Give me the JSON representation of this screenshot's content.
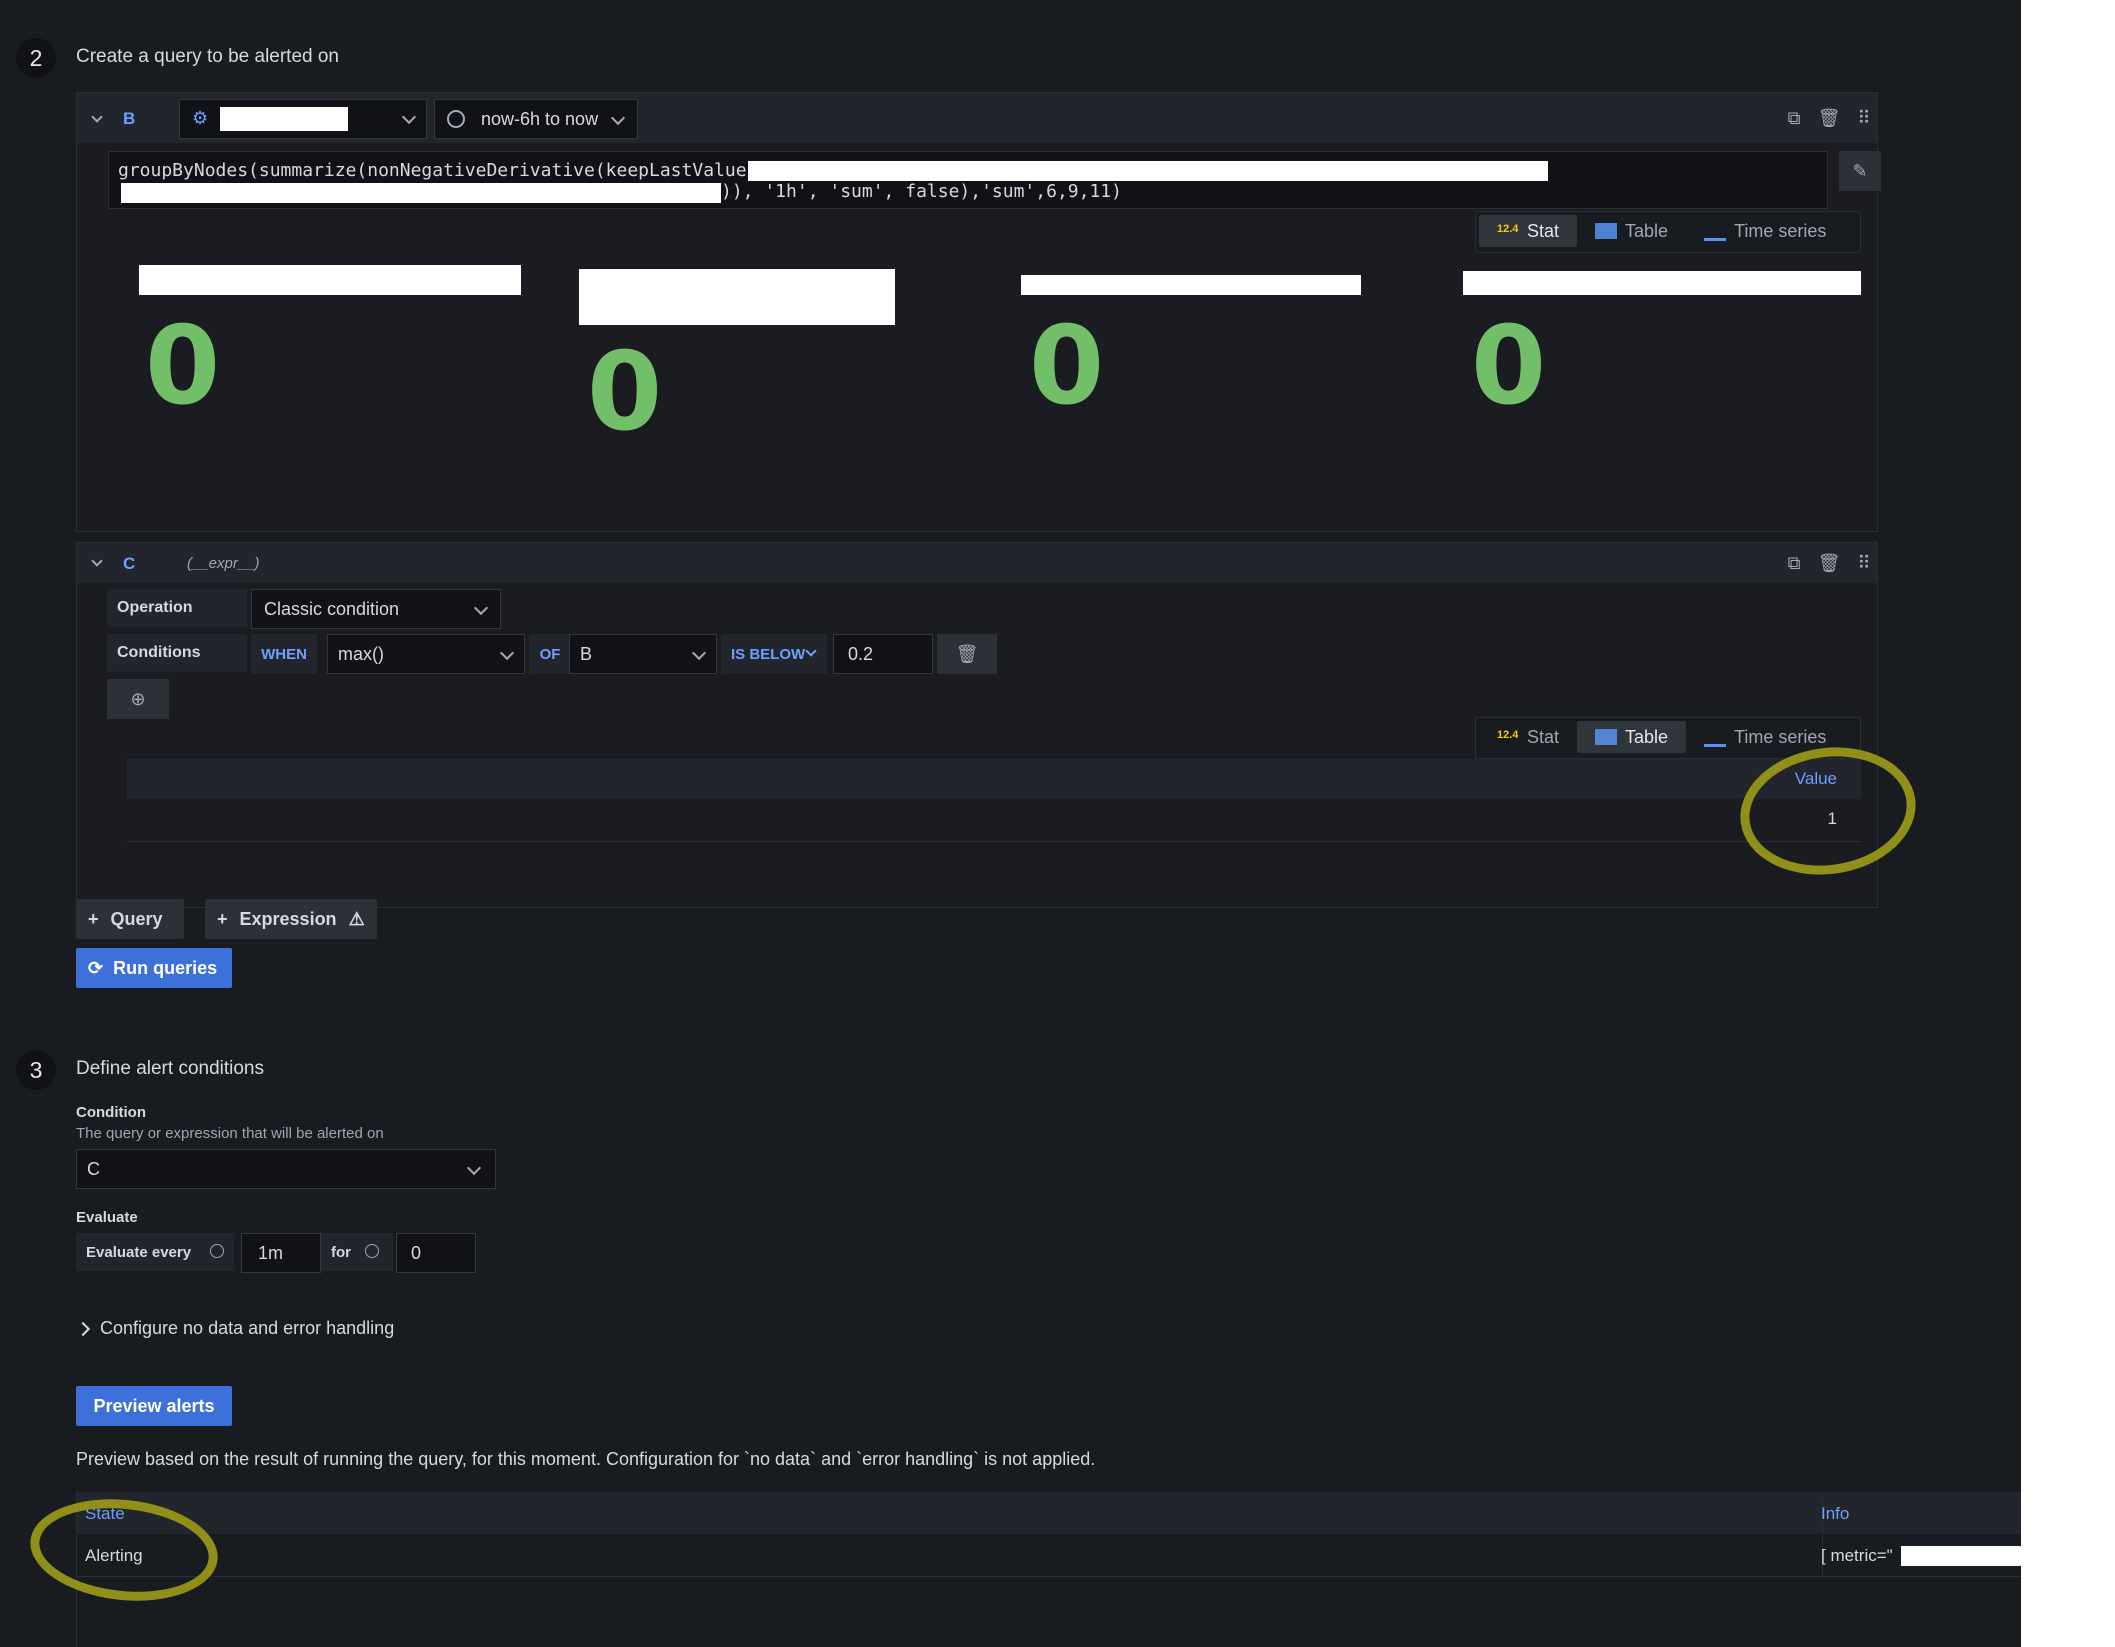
{
  "step2": {
    "number": "2",
    "title": "Create a query to be alerted on",
    "query_b": {
      "ref_id": "B",
      "time_range": "now-6h to now",
      "query_line1": "groupByNodes(summarize(nonNegativeDerivative(keepLastValue(",
      "query_line2_tail": ")), '1h', 'sum', false),'sum',6,9,11)",
      "views": [
        "Stat",
        "Table",
        "Time series"
      ],
      "active_view": "Stat",
      "stats": [
        "0",
        "0",
        "0",
        "0"
      ]
    },
    "expr_c": {
      "ref_id": "C",
      "name": "(__expr__)",
      "operation_label": "Operation",
      "operation_value": "Classic condition",
      "conditions_label": "Conditions",
      "when_label": "WHEN",
      "reducer": "max()",
      "of_label": "OF",
      "query_ref": "B",
      "evaluator": "IS BELOW",
      "threshold": "0.2",
      "views": [
        "Stat",
        "Table",
        "Time series"
      ],
      "active_view": "Table",
      "table_header": "Value",
      "table_value": "1"
    },
    "add_query_label": "Query",
    "add_expression_label": "Expression",
    "run_queries_label": "Run queries"
  },
  "step3": {
    "number": "3",
    "title": "Define alert conditions",
    "condition_label": "Condition",
    "condition_desc": "The query or expression that will be alerted on",
    "condition_value": "C",
    "evaluate_label": "Evaluate",
    "evaluate_every_label": "Evaluate every",
    "evaluate_every_value": "1m",
    "for_label": "for",
    "for_value": "0",
    "no_data_toggle": "Configure no data and error handling",
    "preview_button": "Preview alerts",
    "preview_note": "Preview based on the result of running the query, for this moment. Configuration for `no data` and `error handling` is not applied.",
    "preview_table": {
      "headers": {
        "state": "State",
        "info": "Info"
      },
      "rows": [
        {
          "state": "Alerting",
          "info": "[ metric=\""
        }
      ]
    }
  },
  "colors": {
    "background": "#181b1f",
    "accent_blue": "#3d71d9",
    "stat_green": "#73bf69",
    "highlight_annotation": "#8f8f1a"
  }
}
